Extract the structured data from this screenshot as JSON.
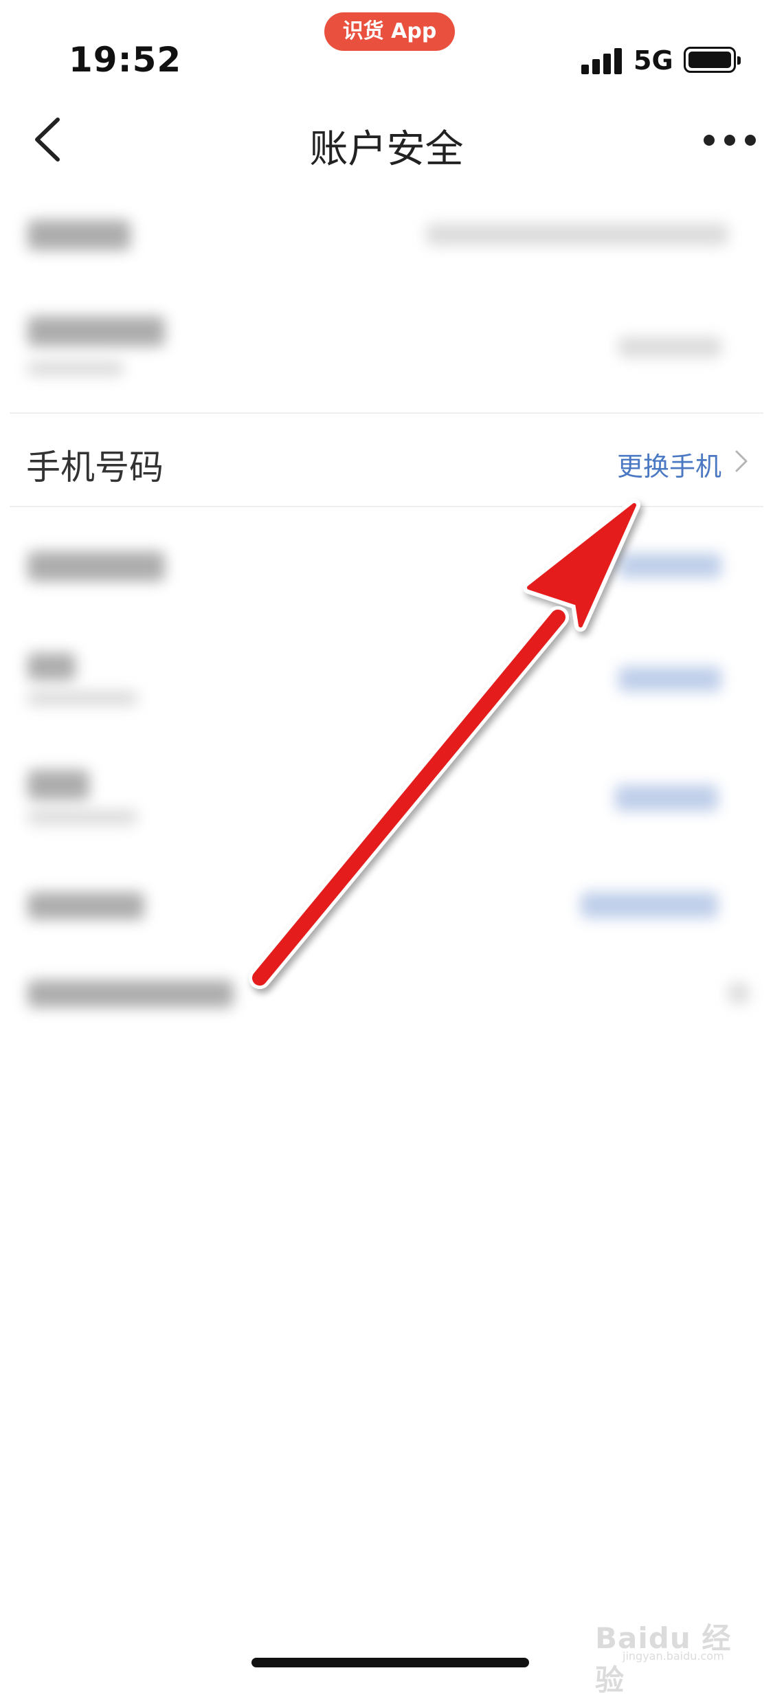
{
  "status_bar": {
    "time": "19:52",
    "app_pill": "识货 App",
    "network": "5G"
  },
  "nav": {
    "title": "账户安全",
    "back_icon": "chevron-left-icon",
    "more_icon": "more-horizontal-icon"
  },
  "list": {
    "phone_row": {
      "label": "手机号码",
      "action": "更换手机",
      "chevron_icon": "chevron-right-icon"
    }
  },
  "annotation": {
    "arrow_color": "#e41b1b"
  },
  "watermark": {
    "brand": "Baidu 经验",
    "url": "jingyan.baidu.com"
  },
  "colors": {
    "accent_link": "#4a78c2",
    "app_pill": "#e9503e"
  }
}
